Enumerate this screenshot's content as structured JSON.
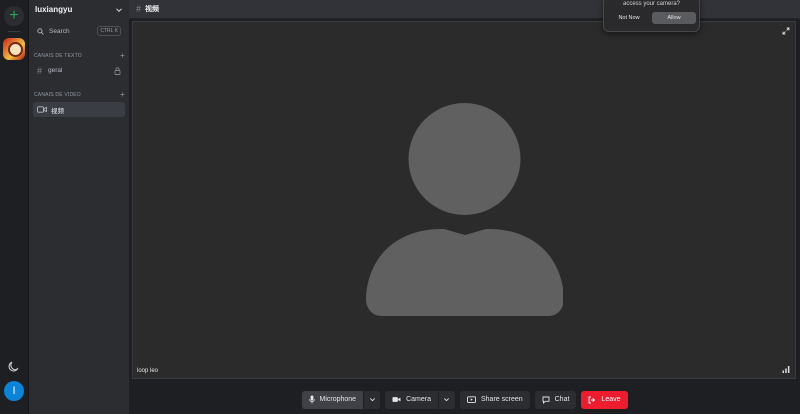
{
  "server": {
    "name": "luxiangyu",
    "user_initial": "I"
  },
  "search": {
    "label": "Search",
    "shortcut": "CTRL K"
  },
  "sections": {
    "text": "CANAIS DE TEXTO",
    "video": "CANAIS DE VIDEO"
  },
  "channels": {
    "text_channel": "geral",
    "video_channel": "视频"
  },
  "topbar": {
    "channel_name": "视频"
  },
  "stage": {
    "participant_name": "loop leo"
  },
  "controls": {
    "microphone": "Microphone",
    "camera": "Camera",
    "share_screen": "Share screen",
    "chat": "Chat",
    "leave": "Leave"
  },
  "permission_popup": {
    "question": "access your camera?",
    "deny": "Not Now",
    "allow": "Allow"
  },
  "colors": {
    "leave": "#ed1c2e",
    "accent_green": "#23a559",
    "avatar_blue": "#0a84d8",
    "placeholder_gray": "#606061"
  },
  "icons": [
    "plus-icon",
    "moon-icon",
    "chevron-down-icon",
    "search-icon",
    "hash-icon",
    "lock-icon",
    "video-camera-icon",
    "expand-icon",
    "signal-icon",
    "microphone-icon",
    "share-screen-icon",
    "chat-icon",
    "leave-icon",
    "person-placeholder-icon"
  ]
}
